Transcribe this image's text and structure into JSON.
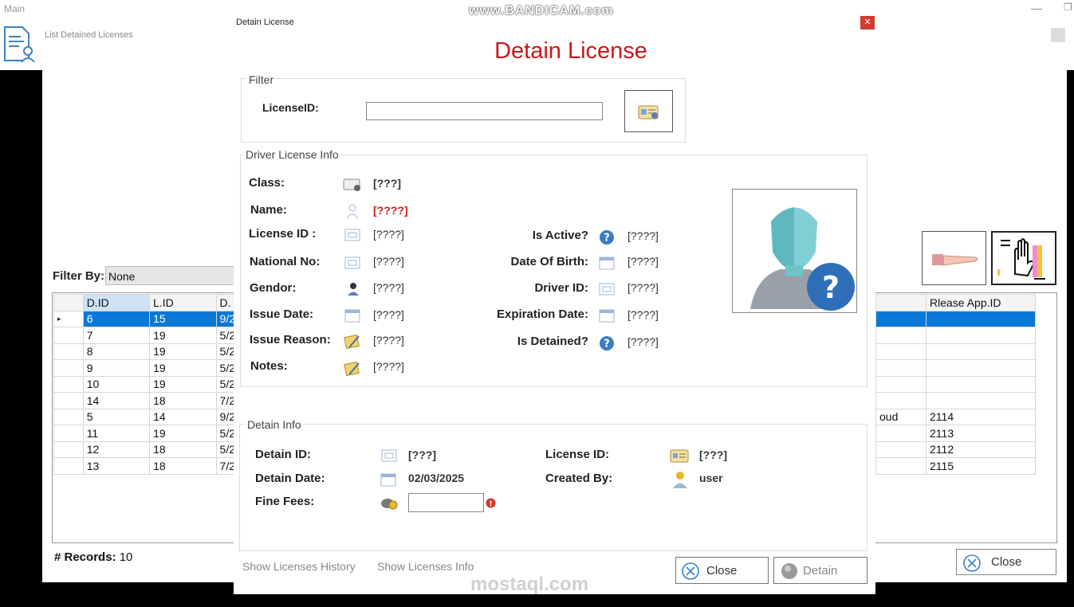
{
  "watermark": "www.BANDICAM.com",
  "main_window": {
    "title": "Main",
    "list_title": "List Detained Licenses",
    "filter_by_label": "Filter By:",
    "filter_by_value": "None",
    "columns_left": [
      "D.ID",
      "L.ID",
      "D."
    ],
    "columns_right": [
      "",
      "Rlease App.ID"
    ],
    "rows": [
      {
        "did": "6",
        "lid": "15",
        "d": "9/2",
        "name_frag": "",
        "release": ""
      },
      {
        "did": "7",
        "lid": "19",
        "d": "5/2",
        "name_frag": "",
        "release": ""
      },
      {
        "did": "8",
        "lid": "19",
        "d": "5/2",
        "name_frag": "",
        "release": ""
      },
      {
        "did": "9",
        "lid": "19",
        "d": "5/2",
        "name_frag": "",
        "release": ""
      },
      {
        "did": "10",
        "lid": "19",
        "d": "5/2",
        "name_frag": "",
        "release": ""
      },
      {
        "did": "14",
        "lid": "18",
        "d": "7/2",
        "name_frag": "",
        "release": ""
      },
      {
        "did": "5",
        "lid": "14",
        "d": "9/2",
        "name_frag": "oud",
        "release": "2114"
      },
      {
        "did": "11",
        "lid": "19",
        "d": "5/2",
        "name_frag": "",
        "release": "2113"
      },
      {
        "did": "12",
        "lid": "18",
        "d": "5/2",
        "name_frag": "",
        "release": "2112"
      },
      {
        "did": "13",
        "lid": "18",
        "d": "7/2",
        "name_frag": "",
        "release": "2115"
      }
    ],
    "records_label": "# Records:",
    "records_count": "10",
    "close_label": "Close"
  },
  "dialog": {
    "window_title": "Detain License",
    "heading": "Detain License",
    "filter": {
      "group_title": "Filter",
      "license_id_label": "LicenseID:",
      "license_id_value": ""
    },
    "driver_info": {
      "group_title": "Driver License Info",
      "class_label": "Class:",
      "class_value": "[???]",
      "name_label": "Name:",
      "name_value": "[????]",
      "license_id_label": "License ID :",
      "license_id_value": "[????]",
      "national_no_label": "National No:",
      "national_no_value": "[????]",
      "gendor_label": "Gendor:",
      "gendor_value": "[????]",
      "issue_date_label": "Issue Date:",
      "issue_date_value": "[????]",
      "issue_reason_label": "Issue Reason:",
      "issue_reason_value": "[????]",
      "notes_label": "Notes:",
      "notes_value": "[????]",
      "is_active_label": "Is Active?",
      "is_active_value": "[????]",
      "dob_label": "Date Of Birth:",
      "dob_value": "[????]",
      "driver_id_label": "Driver ID:",
      "driver_id_value": "[????]",
      "expiration_label": "Expiration Date:",
      "expiration_value": "[????]",
      "is_detained_label": "Is Detained?",
      "is_detained_value": "[????]"
    },
    "detain_info": {
      "group_title": "Detain Info",
      "detain_id_label": "Detain ID:",
      "detain_id_value": "[???]",
      "detain_date_label": "Detain Date:",
      "detain_date_value": "02/03/2025",
      "fine_fees_label": "Fine Fees:",
      "fine_fees_value": "",
      "license_id_label": "License ID:",
      "license_id_value": "[???]",
      "created_by_label": "Created By:",
      "created_by_value": "user"
    },
    "links": {
      "history": "Show Licenses History",
      "info": "Show Licenses Info"
    },
    "buttons": {
      "close": "Close",
      "detain": "Detain"
    }
  },
  "colors": {
    "heading": "#c8181a",
    "selection": "#0a78d7",
    "close_x": "#d23b2e"
  },
  "bottom_watermark": "mostaql.com"
}
